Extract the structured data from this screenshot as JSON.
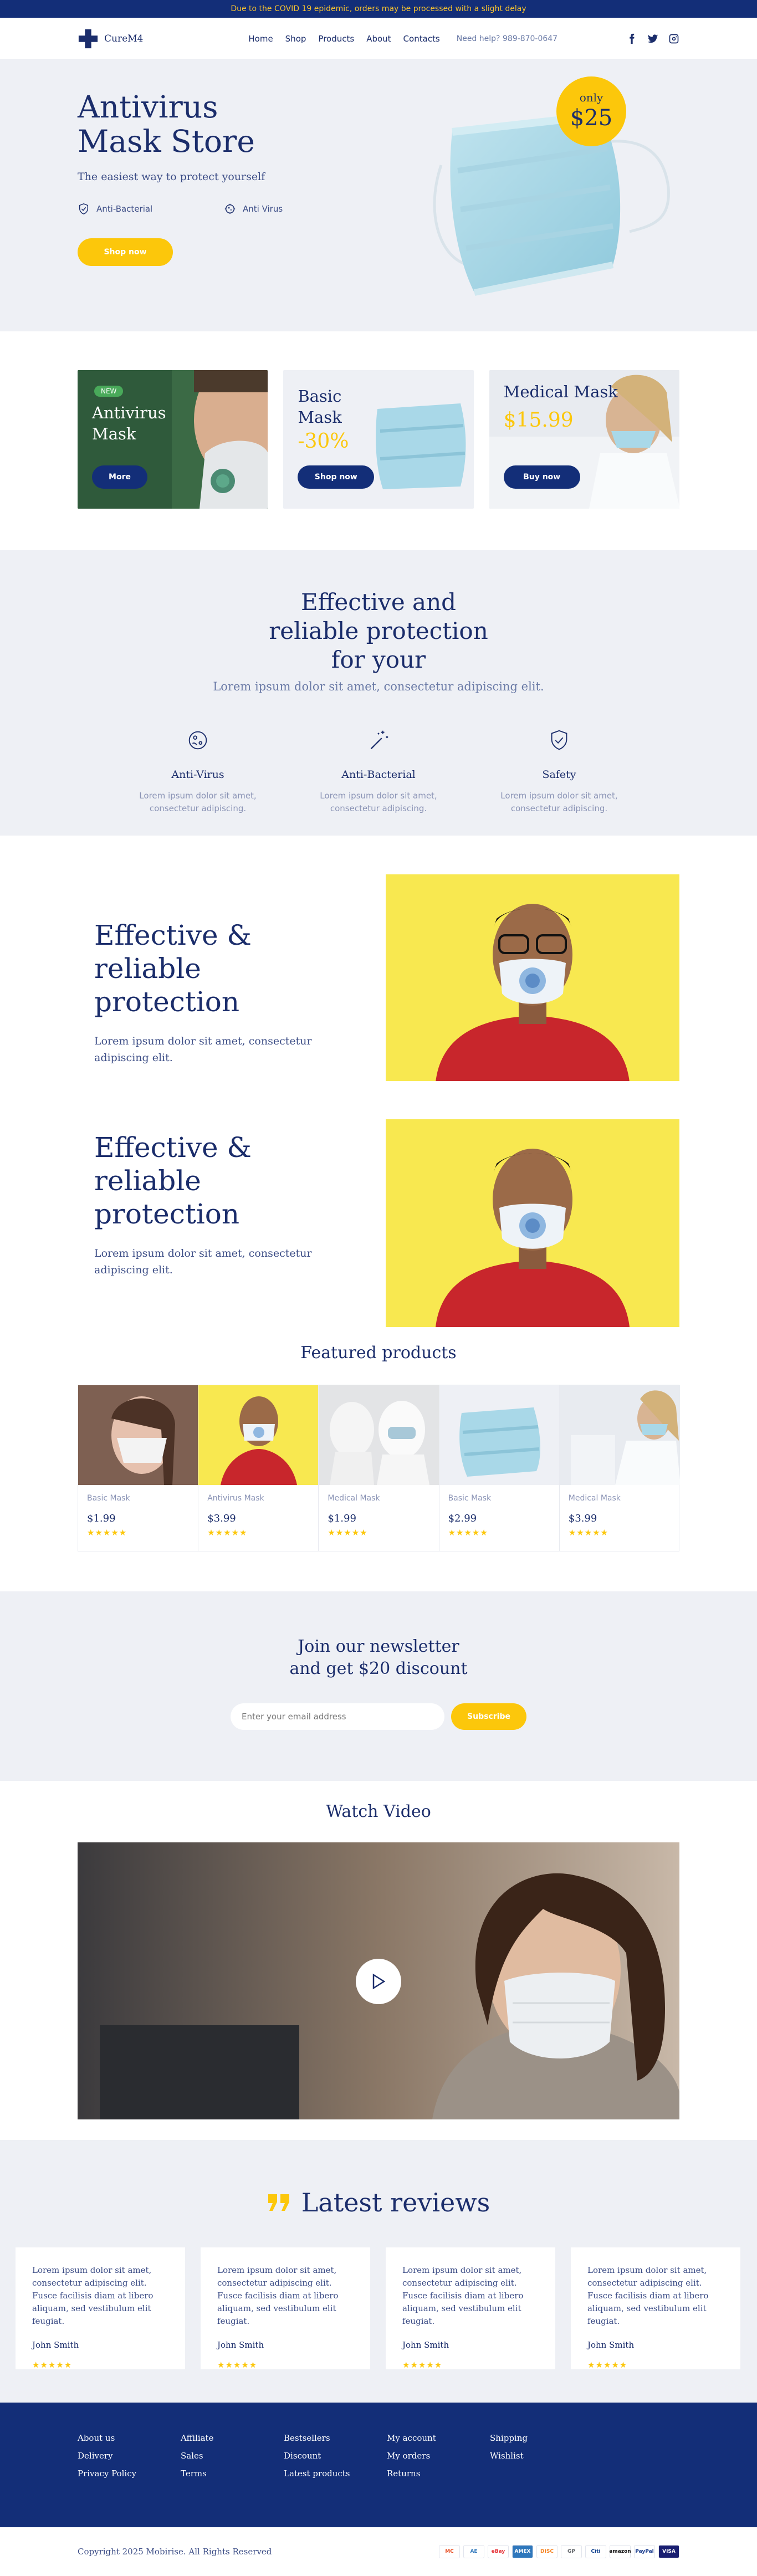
{
  "topbar": {
    "text": "Due to the COVID 19 epidemic, orders may be processed with a slight delay"
  },
  "header": {
    "logo": "CureM4",
    "nav": [
      "Home",
      "Shop",
      "Products",
      "About",
      "Contacts"
    ],
    "help": "Need help? 989-870-0647",
    "social_icons": [
      "facebook-icon",
      "twitter-icon",
      "instagram-icon"
    ]
  },
  "hero": {
    "title": "Antivirus Mask Store",
    "tagline": "The easiest way to protect yourself",
    "features": [
      "Anti-Bacterial",
      "Anti Virus"
    ],
    "button": "Shop now",
    "badge_only": "only",
    "badge_price": "$25"
  },
  "promos": [
    {
      "badge": "NEW",
      "title": "Antivirus Mask",
      "button": "More"
    },
    {
      "title": "Basic Mask",
      "discount": "-30%",
      "button": "Shop now"
    },
    {
      "title": "Medical Mask",
      "price": "$15.99",
      "button": "Buy now"
    }
  ],
  "protection": {
    "title": "Effective and reliable protection for your",
    "subtitle": "Lorem ipsum dolor sit amet, consectetur adipiscing elit.",
    "items": [
      {
        "icon": "virus-icon",
        "title": "Anti-Virus",
        "desc": "Lorem ipsum dolor sit amet, consectetur adipiscing."
      },
      {
        "icon": "sparkle-wand-icon",
        "title": "Anti-Bacterial",
        "desc": "Lorem ipsum dolor sit amet, consectetur adipiscing."
      },
      {
        "icon": "shield-check-icon",
        "title": "Safety",
        "desc": "Lorem ipsum dolor sit amet, consectetur adipiscing."
      }
    ]
  },
  "rows": [
    {
      "title": "Effective & reliable protection",
      "text": "Lorem ipsum dolor sit amet, consectetur adipiscing elit."
    },
    {
      "title": "Effective & reliable protection",
      "text": "Lorem ipsum dolor sit amet, consectetur adipiscing elit."
    }
  ],
  "featured": {
    "title": "Featured products",
    "products": [
      {
        "name": "Basic Mask",
        "price": "$1.99",
        "stars": "★★★★★"
      },
      {
        "name": "Antivirus Mask",
        "price": "$3.99",
        "stars": "★★★★★"
      },
      {
        "name": "Medical Mask",
        "price": "$1.99",
        "stars": "★★★★★"
      },
      {
        "name": "Basic Mask",
        "price": "$2.99",
        "stars": "★★★★★"
      },
      {
        "name": "Medical Mask",
        "price": "$3.99",
        "stars": "★★★★★"
      }
    ]
  },
  "newsletter": {
    "title": "Join our newsletter and get $20 discount",
    "placeholder": "Enter your email address",
    "button": "Subscribe"
  },
  "video": {
    "title": "Watch Video"
  },
  "reviews": {
    "title": "Latest reviews",
    "items": [
      {
        "text": "Lorem ipsum dolor sit amet, consectetur adipiscing elit. Fusce facilisis diam at libero aliquam, sed vestibulum elit feugiat.",
        "author": "John Smith",
        "stars": "★★★★★"
      },
      {
        "text": "Lorem ipsum dolor sit amet, consectetur adipiscing elit. Fusce facilisis diam at libero aliquam, sed vestibulum elit feugiat.",
        "author": "John Smith",
        "stars": "★★★★★"
      },
      {
        "text": "Lorem ipsum dolor sit amet, consectetur adipiscing elit. Fusce facilisis diam at libero aliquam, sed vestibulum elit feugiat.",
        "author": "John Smith",
        "stars": "★★★★★"
      },
      {
        "text": "Lorem ipsum dolor sit amet, consectetur adipiscing elit. Fusce facilisis diam at libero aliquam, sed vestibulum elit feugiat.",
        "author": "John Smith",
        "stars": "★★★★★"
      }
    ]
  },
  "footer": {
    "columns": [
      [
        "About us",
        "Delivery",
        "Privacy Policy"
      ],
      [
        "Affiliate",
        "Sales",
        "Terms"
      ],
      [
        "Bestsellers",
        "Discount",
        "Latest products"
      ],
      [
        "My account",
        "My orders",
        "Returns"
      ],
      [
        "Shipping",
        "Wishlist"
      ]
    ],
    "copyright": "Copyright 2025 Mobirise. All Rights Reserved",
    "payments": [
      "MC",
      "AE",
      "eBay",
      "AMEX",
      "DISC",
      "GP",
      "Citi",
      "amazon",
      "PayPal",
      "VISA"
    ]
  },
  "colors": {
    "navy": "#132e78",
    "yellow": "#fcc70b",
    "light_bg": "#eef0f5"
  }
}
